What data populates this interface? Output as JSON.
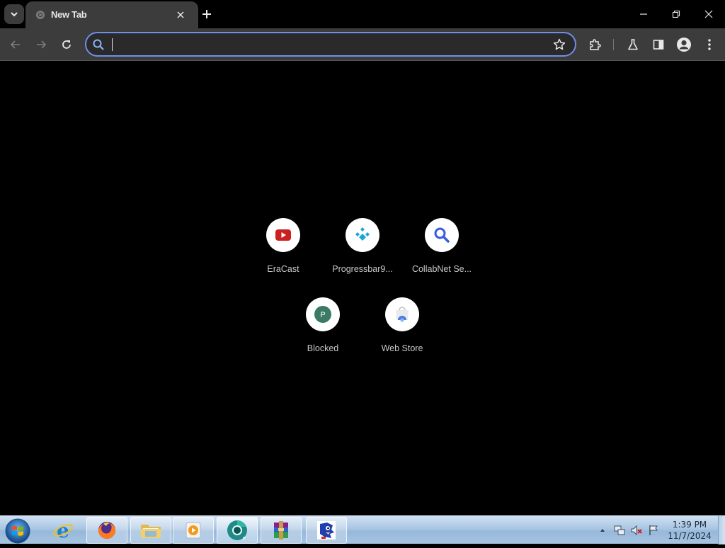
{
  "browser": {
    "tab": {
      "title": "New Tab"
    },
    "omnibox": {
      "value": "",
      "placeholder": ""
    }
  },
  "shortcuts": [
    {
      "label": "EraCast",
      "icon": "youtube-play-icon"
    },
    {
      "label": "Progressbar9...",
      "icon": "progressbar-logo-icon"
    },
    {
      "label": "CollabNet Se...",
      "icon": "magnifier-icon"
    },
    {
      "label": "Blocked",
      "icon": "letter-p-icon",
      "letter": "P"
    },
    {
      "label": "Web Store",
      "icon": "web-store-icon"
    }
  ],
  "taskbar": {
    "apps": [
      "start-orb",
      "internet-explorer",
      "firefox",
      "file-explorer",
      "media-player",
      "chrome-canary",
      "winrar",
      "sonic-game"
    ],
    "clock": {
      "time": "1:39 PM",
      "date": "11/7/2024"
    }
  },
  "colors": {
    "page_bg": "#000000",
    "toolbar_bg": "#3c3c3c",
    "omnibox_border": "#6d8fe8",
    "youtube_red": "#cc1f1f",
    "progress_cyan": "#19a7d6",
    "collab_blue": "#3b5bdb",
    "blocked_green": "#3b7a64"
  }
}
